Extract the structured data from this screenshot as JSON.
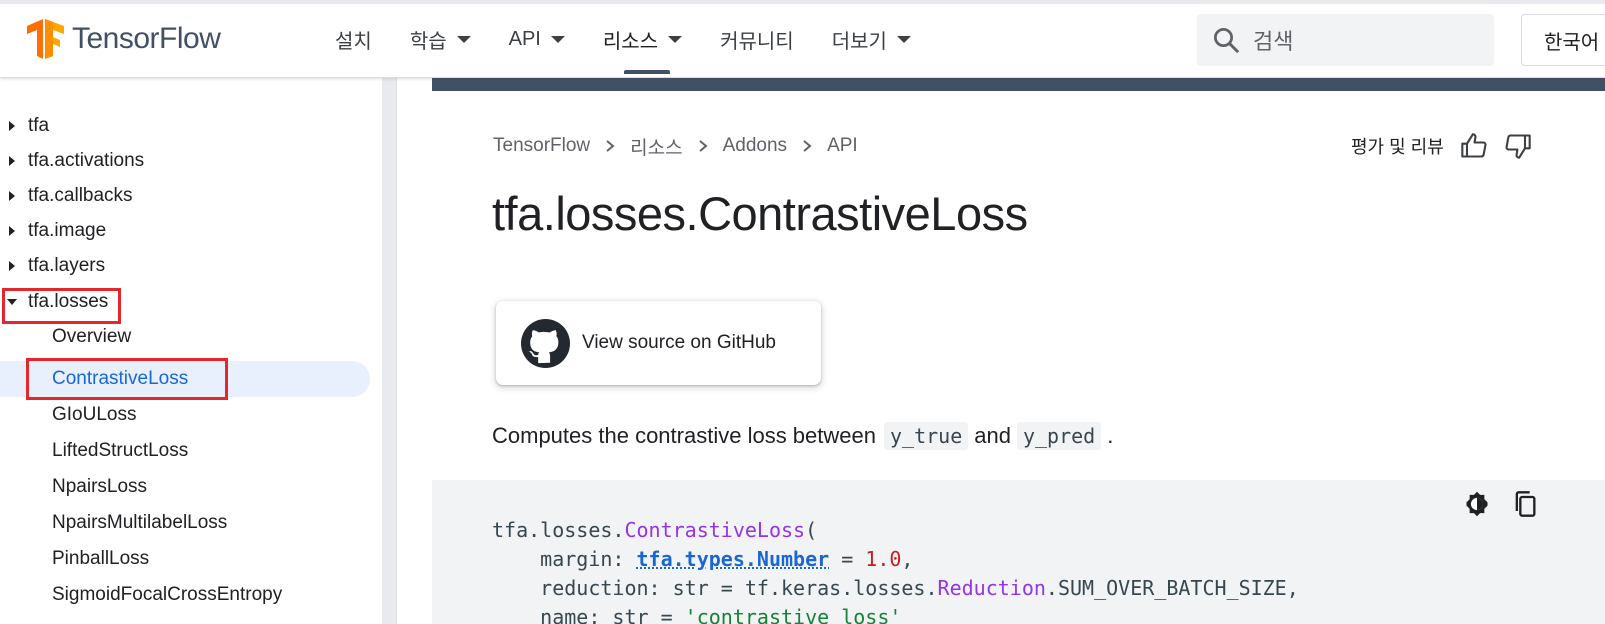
{
  "header": {
    "brand": "TensorFlow",
    "nav": [
      {
        "label": "설치",
        "dropdown": false,
        "active": false
      },
      {
        "label": "학습",
        "dropdown": true,
        "active": false
      },
      {
        "label": "API",
        "dropdown": true,
        "active": false
      },
      {
        "label": "리소스",
        "dropdown": true,
        "active": true
      },
      {
        "label": "커뮤니티",
        "dropdown": false,
        "active": false
      },
      {
        "label": "더보기",
        "dropdown": true,
        "active": false
      }
    ],
    "search_placeholder": "검색",
    "language": "한국어"
  },
  "sidebar": {
    "items": [
      {
        "label": "tfa",
        "expanded": false
      },
      {
        "label": "tfa.activations",
        "expanded": false
      },
      {
        "label": "tfa.callbacks",
        "expanded": false
      },
      {
        "label": "tfa.image",
        "expanded": false
      },
      {
        "label": "tfa.layers",
        "expanded": false
      },
      {
        "label": "tfa.losses",
        "expanded": true
      }
    ],
    "sub_items": [
      "Overview",
      "ContrastiveLoss",
      "GIoULoss",
      "LiftedStructLoss",
      "NpairsLoss",
      "NpairsMultilabelLoss",
      "PinballLoss",
      "SigmoidFocalCrossEntropy"
    ],
    "selected": "ContrastiveLoss"
  },
  "breadcrumb": [
    "TensorFlow",
    "리소스",
    "Addons",
    "API"
  ],
  "rating_label": "평가 및 리뷰",
  "page_title": "tfa.losses.ContrastiveLoss",
  "github_button": "View source on GitHub",
  "description": {
    "text": "Computes the contrastive loss between",
    "code1": "y_true",
    "conj": "and",
    "code2": "y_pred",
    "end": "."
  },
  "code": {
    "l1_module": "tfa.losses.",
    "l1_class": "ContrastiveLoss",
    "l1_paren": "(",
    "l2_param": "    margin: ",
    "l2_type": "tfa.types.Number",
    "l2_eq": " = ",
    "l2_val": "1.0",
    "l2_comma": ",",
    "l3_param": "    reduction: str = tf.keras.losses.",
    "l3_class": "Reduction",
    "l3_rest": ".SUM_OVER_BATCH_SIZE,",
    "l4_param": "    name: str = ",
    "l4_val": "'contrastive_loss'"
  },
  "colors": {
    "brand_orange": "#FF6F00",
    "brand_text": "#425066",
    "selected_text": "#1967d2",
    "selected_bg": "#e8f0fe",
    "highlight_box": "#e3272b"
  }
}
